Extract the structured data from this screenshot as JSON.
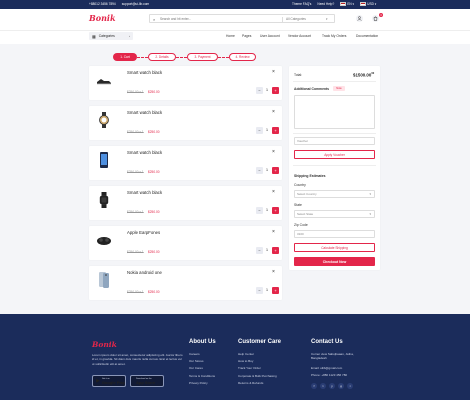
{
  "topbar": {
    "phone": "+88012 3456 7894",
    "email": "support@ui-lib.com",
    "faq": "Theme FAQ's",
    "help": "Need Help?",
    "language": "EN",
    "currency": "USD"
  },
  "header": {
    "logo": "Bonik",
    "search_placeholder": "Search and hit enter...",
    "category_select": "All Categories",
    "cart_count": "3"
  },
  "nav": {
    "categories_label": "Categories",
    "links": [
      "Home",
      "Pages",
      "User Account",
      "Vendor Account",
      "Track My Orders",
      "Documentation"
    ]
  },
  "steps": [
    "1. Cart",
    "2. Details",
    "3. Payment",
    "4. Review"
  ],
  "cart": {
    "items": [
      {
        "name": "Smart watch black",
        "old_price": "$250.00 x 1",
        "new_price": "$250.00",
        "qty": "1",
        "thumb": "shoe-icon"
      },
      {
        "name": "Smart watch black",
        "old_price": "$250.00 x 1",
        "new_price": "$250.00",
        "qty": "1",
        "thumb": "watch-icon"
      },
      {
        "name": "Smart watch black",
        "old_price": "$250.00 x 1",
        "new_price": "$250.00",
        "qty": "1",
        "thumb": "phone-icon"
      },
      {
        "name": "Smart watch black",
        "old_price": "$250.00 x 1",
        "new_price": "$250.00",
        "qty": "1",
        "thumb": "smartwatch-icon"
      },
      {
        "name": "Apple EarpFones",
        "old_price": "$250.00 x 1",
        "new_price": "$250.00",
        "qty": "1",
        "thumb": "earbuds-icon"
      },
      {
        "name": "Nokia android one",
        "old_price": "$250.00 x 1",
        "new_price": "$250.00",
        "qty": "1",
        "thumb": "phone-silver-icon"
      }
    ]
  },
  "summary": {
    "total_label": "Total:",
    "total_value": "$1500.00",
    "total_cents": "00",
    "comments_label": "Additional Comments",
    "comments_badge": "Note",
    "voucher_placeholder": "Voucher",
    "apply_voucher": "Apply Voucher",
    "shipping_estimates": "Shipping Estimates",
    "country_label": "Country",
    "country_value": "Select Country",
    "state_label": "State",
    "state_value": "Select State",
    "zip_label": "Zip Code",
    "zip_value": "3100",
    "calculate_shipping": "Calculate Shipping",
    "checkout": "Checkout Now"
  },
  "footer": {
    "logo": "Bonik",
    "description": "Lorem ipsum dolor sit amet, consectetur adipiscing elit. Auctor libero id et, in gravida. Sit diam duis mauris nulla cursus. Erat et lectus vel ut sollicitudin elit at amet.",
    "google_play_small": "Get it on",
    "google_play": "Google Play",
    "app_store_small": "Download on the",
    "app_store": "App Store",
    "about_heading": "About Us",
    "about_links": [
      "Careers",
      "Our Stores",
      "Our Cares",
      "Terms & Conditions",
      "Privacy Policy"
    ],
    "care_heading": "Customer Care",
    "care_links": [
      "Help Center",
      "How to Buy",
      "Track Your Order",
      "Corporate & Bulk Purchasing",
      "Returns & Refunds"
    ],
    "contact_heading": "Contact Us",
    "contact_address": "Corner view Sabujbaaan, Jafna, Bangladesh",
    "contact_email": "Email: uilib@gmail.com",
    "contact_phone": "Phone: +880 1123 456 780",
    "social": [
      "f",
      "t",
      "y",
      "g",
      "i"
    ]
  },
  "colors": {
    "accent": "#e3264a",
    "navy": "#1b2c5b"
  }
}
